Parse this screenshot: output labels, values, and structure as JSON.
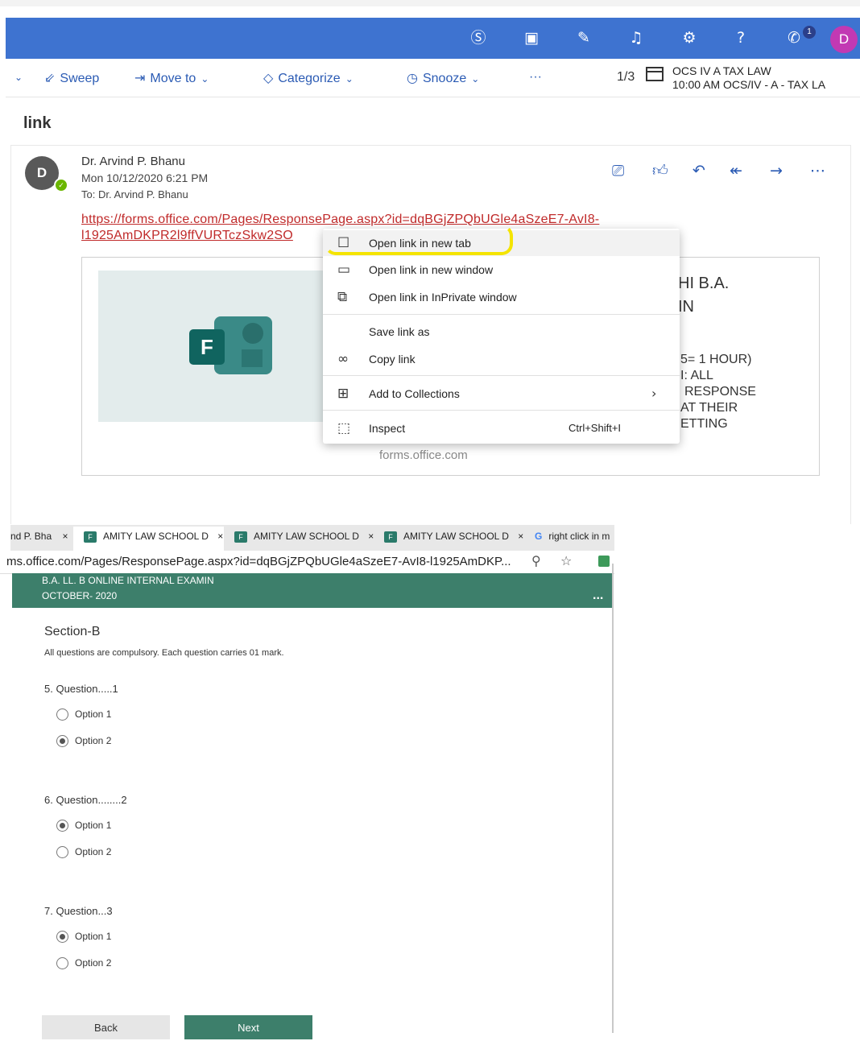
{
  "outlook": {
    "top_bar": {
      "icons": [
        "skype-icon",
        "office-icon",
        "feedback-icon",
        "bell-icon",
        "gear-icon",
        "help-icon",
        "megaphone-icon"
      ],
      "notification_count": "1",
      "avatar_initial": "D",
      "bar_color": "#3e73d0"
    },
    "toolbar": {
      "sweep": "Sweep",
      "move_to": "Move to",
      "categorize": "Categorize",
      "snooze": "Snooze",
      "more": "···",
      "pager": "1/3",
      "event_title": "OCS IV A TAX LAW",
      "event_subtitle": "10:00 AM OCS/IV - A - TAX LA"
    },
    "subject": "link",
    "message": {
      "avatar_initial": "D",
      "sender": "Dr. Arvind P. Bhanu",
      "date": "Mon 10/12/2020 6:21 PM",
      "to": "To:  Dr. Arvind P. Bhanu",
      "link_line1": "https://forms.office.com/Pages/ResponsePage.aspx?id=dqBGjZPQbUGle4aSzeE7-AvI8-",
      "link_line2": "l1925AmDKPR2l9ffVURTczSkw2SO",
      "preview_domain": "forms.office.com",
      "preview_lines": [
        "HI B.A.",
        "IN",
        "5= 1 HOUR)",
        "I: ALL",
        "RESPONSE",
        "AT THEIR",
        "ETTING"
      ]
    },
    "context_menu": {
      "items": [
        {
          "label": "Open link in new tab",
          "icon": "new-tab-icon"
        },
        {
          "label": "Open link in new window",
          "icon": "new-window-icon"
        },
        {
          "label": "Open link in InPrivate window",
          "icon": "inprivate-icon"
        },
        {
          "label": "Save link as",
          "icon": ""
        },
        {
          "label": "Copy link",
          "icon": "link-icon"
        },
        {
          "label": "Add to Collections",
          "icon": "collections-icon"
        },
        {
          "label": "Inspect",
          "icon": "inspect-icon",
          "shortcut": "Ctrl+Shift+I"
        }
      ],
      "highlight_color": "#f4e400"
    }
  },
  "browser": {
    "tabs": [
      {
        "label": "nd P. Bha",
        "close": "×"
      },
      {
        "label": "AMITY LAW SCHOOL D",
        "close": "×"
      },
      {
        "label": "AMITY LAW SCHOOL D",
        "close": "×"
      },
      {
        "label": "AMITY LAW SCHOOL D",
        "close": "×"
      },
      {
        "label": "right click in m"
      }
    ],
    "address": "ms.office.com/Pages/ResponsePage.aspx?id=dqBGjZPQbUGle4aSzeE7-AvI8-l1925AmDKP..."
  },
  "form": {
    "header_line1": "B.A. LL. B ONLINE INTERNAL EXAMIN",
    "header_line2": "OCTOBER- 2020",
    "header_more": "...",
    "section_title": "Section-B",
    "section_desc": "All questions are compulsory. Each question carries 01 mark.",
    "questions": [
      {
        "title": "5. Question.....1",
        "options": [
          "Option 1",
          "Option 2"
        ],
        "selected": 1
      },
      {
        "title": "6. Question........2",
        "options": [
          "Option 1",
          "Option 2"
        ],
        "selected": 0
      },
      {
        "title": "7. Question...3",
        "options": [
          "Option 1",
          "Option 2"
        ],
        "selected": 0
      }
    ],
    "back_label": "Back",
    "next_label": "Next",
    "accent_color": "#3d7f6b"
  }
}
